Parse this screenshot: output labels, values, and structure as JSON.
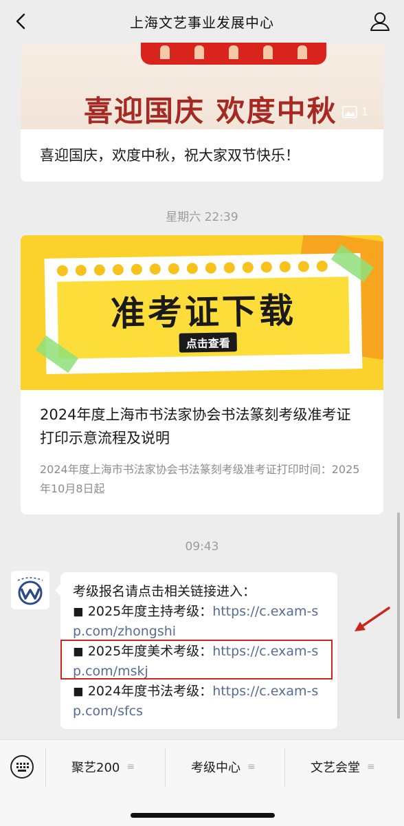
{
  "header": {
    "title": "上海文艺事业发展中心"
  },
  "card1": {
    "banner_text": "喜迎国庆 欢度中秋",
    "image_count": "1",
    "caption": "喜迎国庆，欢度中秋，祝大家双节快乐！"
  },
  "timestamp1": "星期六 22:39",
  "card2": {
    "banner_title": "准考证下载",
    "banner_sub": "点击查看",
    "title": "2024年度上海市书法家协会书法篆刻考级准考证打印示意流程及说明",
    "desc": "2024年度上海市书法家协会书法篆刻考级准考证打印时间：2025年10月8日起"
  },
  "timestamp2": "09:43",
  "message": {
    "intro": "考级报名请点击相关链接进入：",
    "items": [
      {
        "bullet": "◼",
        "label": "2025年度主持考级：",
        "link": "https://c.exam-sp.com/zhongshi"
      },
      {
        "bullet": "◼",
        "label": "2025年度美术考级：",
        "link": "https://c.exam-sp.com/mskj"
      },
      {
        "bullet": "◼",
        "label": "2024年度书法考级：",
        "link": "https://c.exam-sp.com/sfcs"
      }
    ]
  },
  "menu": [
    {
      "label": "聚艺200",
      "icon": "menu-lines-icon"
    },
    {
      "label": "考级中心",
      "icon": "menu-lines-icon"
    },
    {
      "label": "文艺会堂",
      "icon": "menu-lines-icon"
    }
  ],
  "colors": {
    "link": "#576b95",
    "highlight": "#c9271c",
    "banner_yellow": "#fbd22c",
    "banner_red": "#d8241c"
  }
}
